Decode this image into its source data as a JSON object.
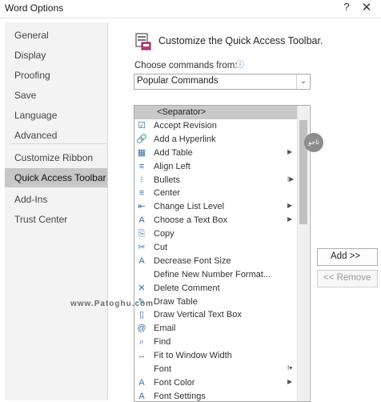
{
  "window": {
    "title": "Word Options",
    "help_glyph": "?",
    "close_glyph": "✕"
  },
  "sidebar": {
    "items": [
      {
        "label": "General"
      },
      {
        "label": "Display"
      },
      {
        "label": "Proofing"
      },
      {
        "label": "Save"
      },
      {
        "label": "Language"
      },
      {
        "label": "Advanced"
      },
      {
        "label": "Customize Ribbon"
      },
      {
        "label": "Quick Access Toolbar"
      },
      {
        "label": "Add-Ins"
      },
      {
        "label": "Trust Center"
      }
    ],
    "selected_index": 7
  },
  "main": {
    "header": "Customize the Quick Access Toolbar.",
    "choose_label": "Choose commands from:",
    "info_glyph": "ⓘ",
    "dropdown_value": "Popular Commands",
    "dropdown_arrow": "⌄",
    "commands": [
      {
        "label": "<Separator>",
        "icon": "",
        "submenu": ""
      },
      {
        "label": "Accept Revision",
        "icon": "☑",
        "submenu": ""
      },
      {
        "label": "Add a Hyperlink",
        "icon": "🔗",
        "submenu": ""
      },
      {
        "label": "Add Table",
        "icon": "▦",
        "submenu": "▶"
      },
      {
        "label": "Align Left",
        "icon": "≡",
        "submenu": ""
      },
      {
        "label": "Bullets",
        "icon": "⁝",
        "submenu": "|▶"
      },
      {
        "label": "Center",
        "icon": "≡",
        "submenu": ""
      },
      {
        "label": "Change List Level",
        "icon": "⇤",
        "submenu": "▶"
      },
      {
        "label": "Choose a Text Box",
        "icon": "A",
        "submenu": "▶"
      },
      {
        "label": "Copy",
        "icon": "⎘",
        "submenu": ""
      },
      {
        "label": "Cut",
        "icon": "✂",
        "submenu": ""
      },
      {
        "label": "Decrease Font Size",
        "icon": "A",
        "submenu": ""
      },
      {
        "label": "Define New Number Format...",
        "icon": "",
        "submenu": ""
      },
      {
        "label": "Delete Comment",
        "icon": "✕",
        "submenu": ""
      },
      {
        "label": "Draw Table",
        "icon": "✎",
        "submenu": ""
      },
      {
        "label": "Draw Vertical Text Box",
        "icon": "▯",
        "submenu": ""
      },
      {
        "label": "Email",
        "icon": "@",
        "submenu": ""
      },
      {
        "label": "Find",
        "icon": "⌕",
        "submenu": ""
      },
      {
        "label": "Fit to Window Width",
        "icon": "↔",
        "submenu": ""
      },
      {
        "label": "Font",
        "icon": "",
        "submenu": "I▾"
      },
      {
        "label": "Font Color",
        "icon": "A",
        "submenu": "▶"
      },
      {
        "label": "Font Settings",
        "icon": "A",
        "submenu": ""
      }
    ],
    "add_button": "Add >>",
    "remove_button": "<< Remove"
  },
  "watermark": "www.Patoghu.com",
  "logo_text": "تاجو"
}
